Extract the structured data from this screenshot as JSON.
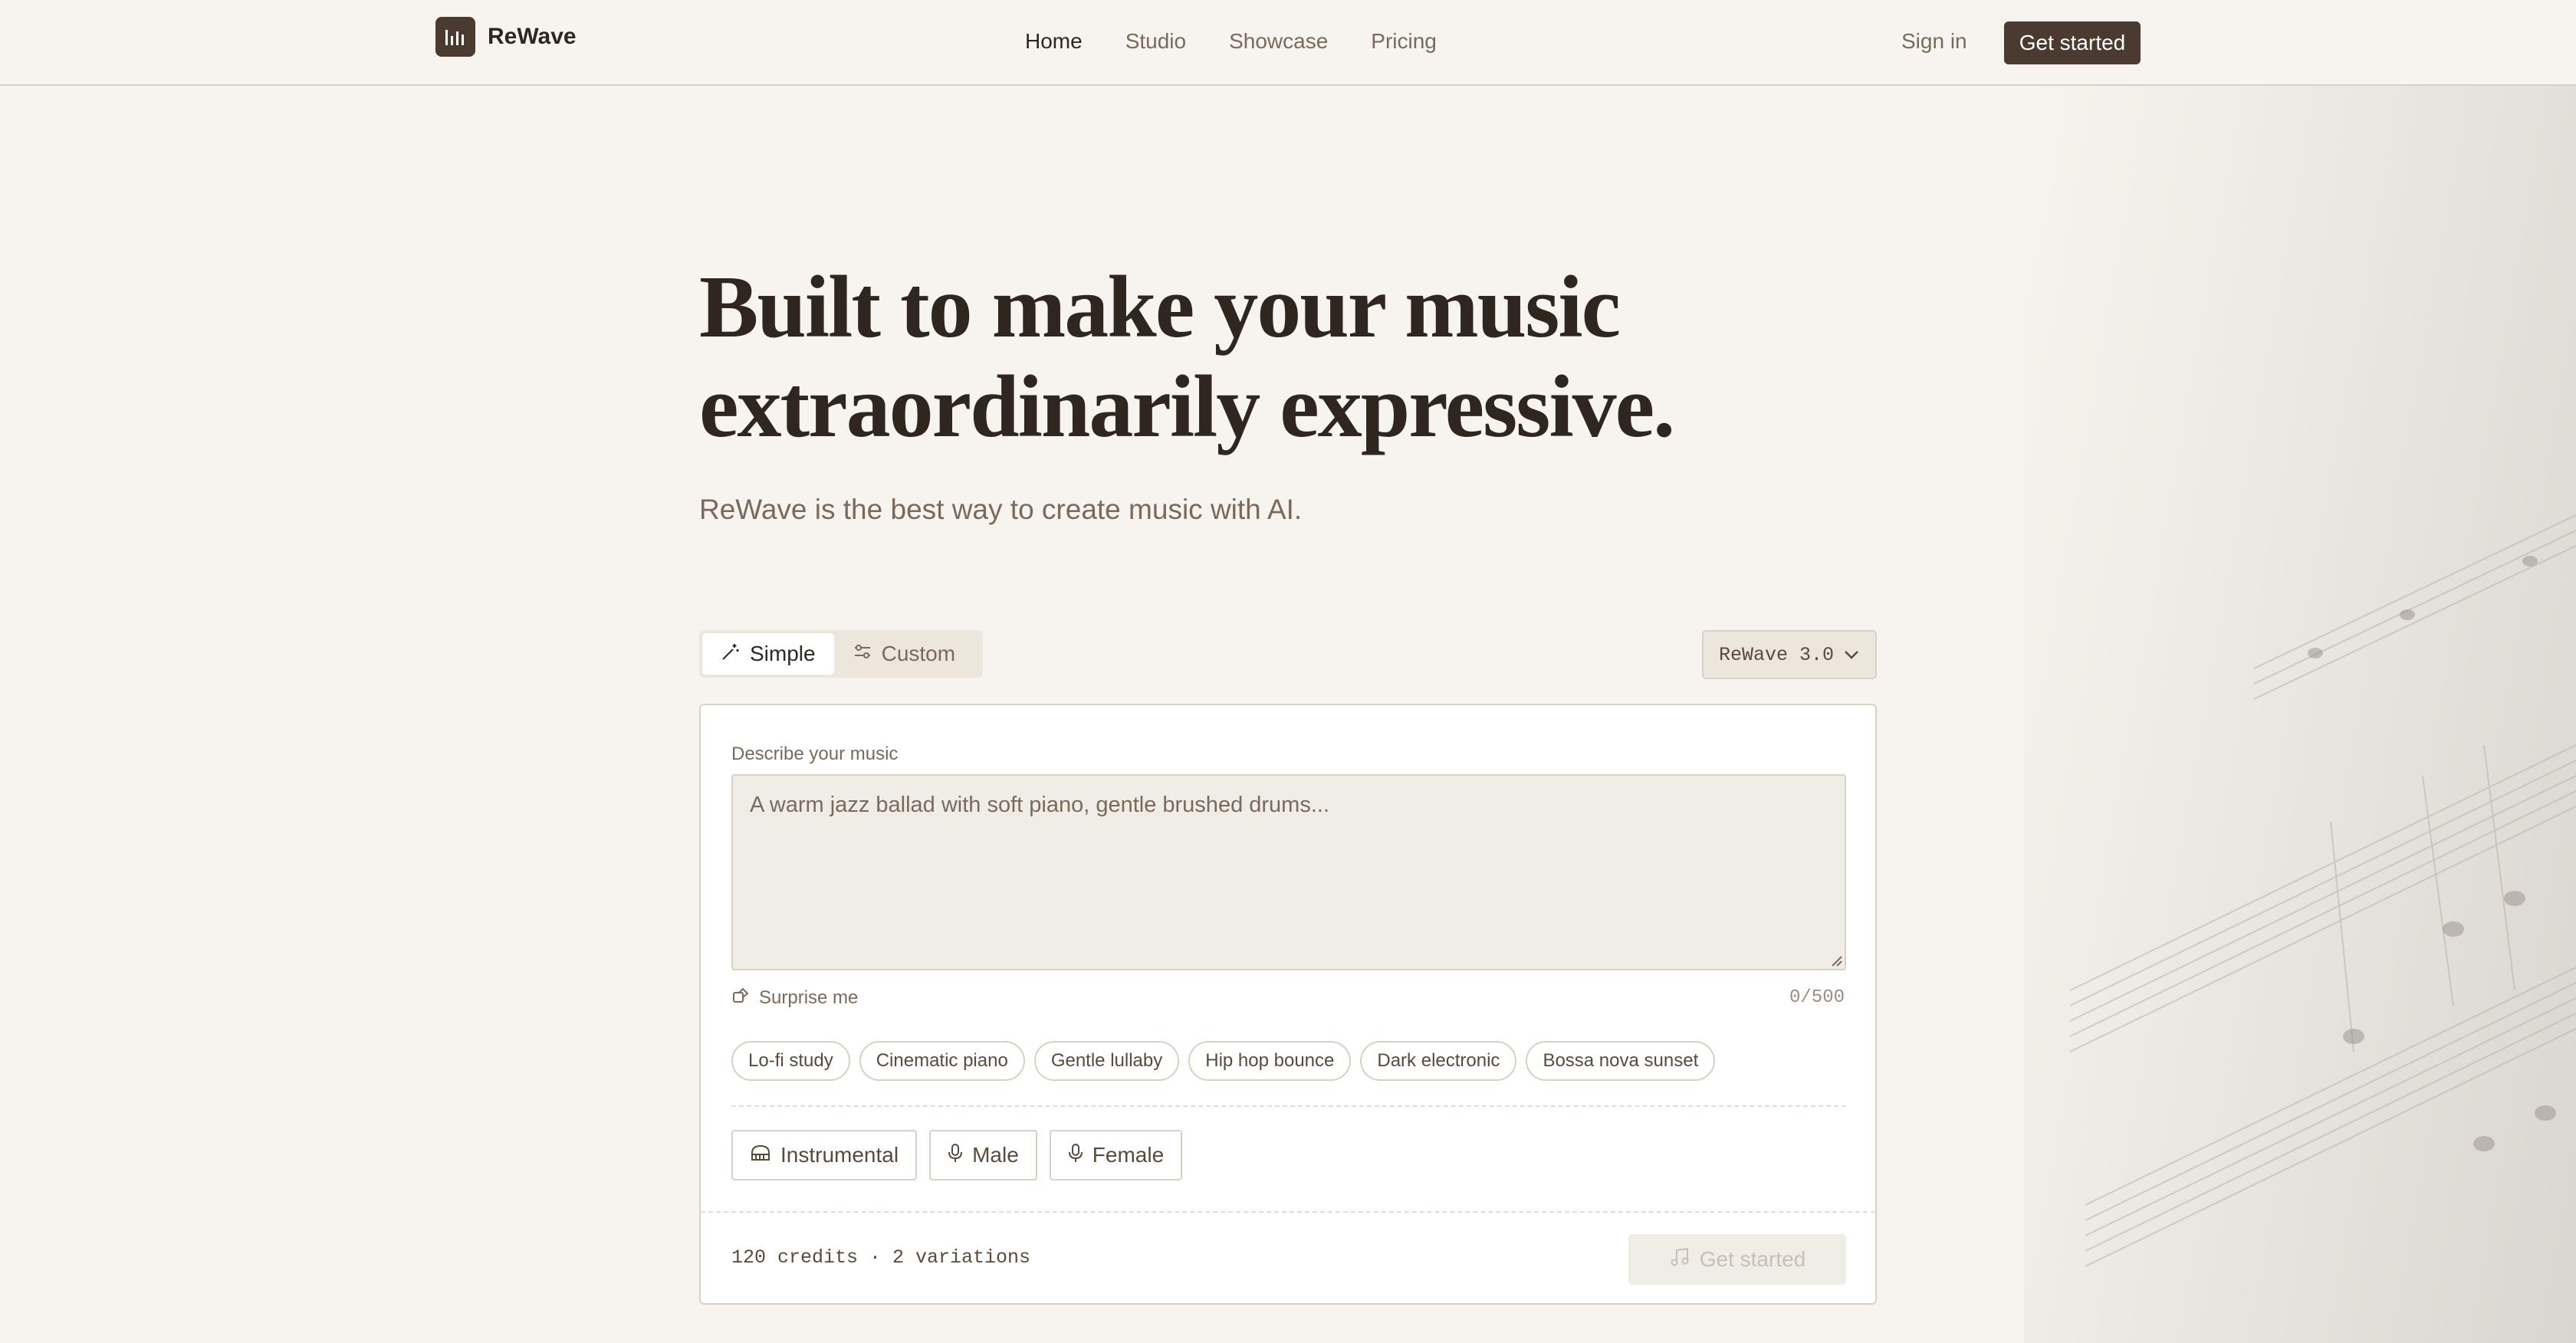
{
  "brand": {
    "name": "ReWave"
  },
  "nav": {
    "items": [
      {
        "label": "Home",
        "active": true
      },
      {
        "label": "Studio",
        "active": false
      },
      {
        "label": "Showcase",
        "active": false
      },
      {
        "label": "Pricing",
        "active": false
      }
    ],
    "signin": "Sign in",
    "cta": "Get started"
  },
  "hero": {
    "title_line1": "Built to make your music",
    "title_line2": "extraordinarily expressive.",
    "subtitle": "ReWave is the best way to create music with AI."
  },
  "mode_tabs": [
    {
      "label": "Simple",
      "icon": "magic-wand-icon",
      "selected": true
    },
    {
      "label": "Custom",
      "icon": "sliders-icon",
      "selected": false
    }
  ],
  "model_select": {
    "value": "ReWave 3.0",
    "icon": "chevron-down-icon"
  },
  "form": {
    "label": "Describe your music",
    "placeholder": "A warm jazz ballad with soft piano, gentle brushed drums...",
    "value": "",
    "surprise": "Surprise me",
    "counter": "0/500",
    "suggestions": [
      "Lo-fi study",
      "Cinematic piano",
      "Gentle lullaby",
      "Hip hop bounce",
      "Dark electronic",
      "Bossa nova sunset"
    ],
    "voices": [
      {
        "label": "Instrumental",
        "icon": "piano-icon"
      },
      {
        "label": "Male",
        "icon": "mic-icon"
      },
      {
        "label": "Female",
        "icon": "mic-icon"
      }
    ],
    "credits": "120 credits · 2 variations",
    "submit": "Get started",
    "submit_icon": "music-note-icon"
  },
  "colors": {
    "brand": "#4a3a2f",
    "background": "#f7f4ef",
    "muted": "#7a6a5c"
  }
}
